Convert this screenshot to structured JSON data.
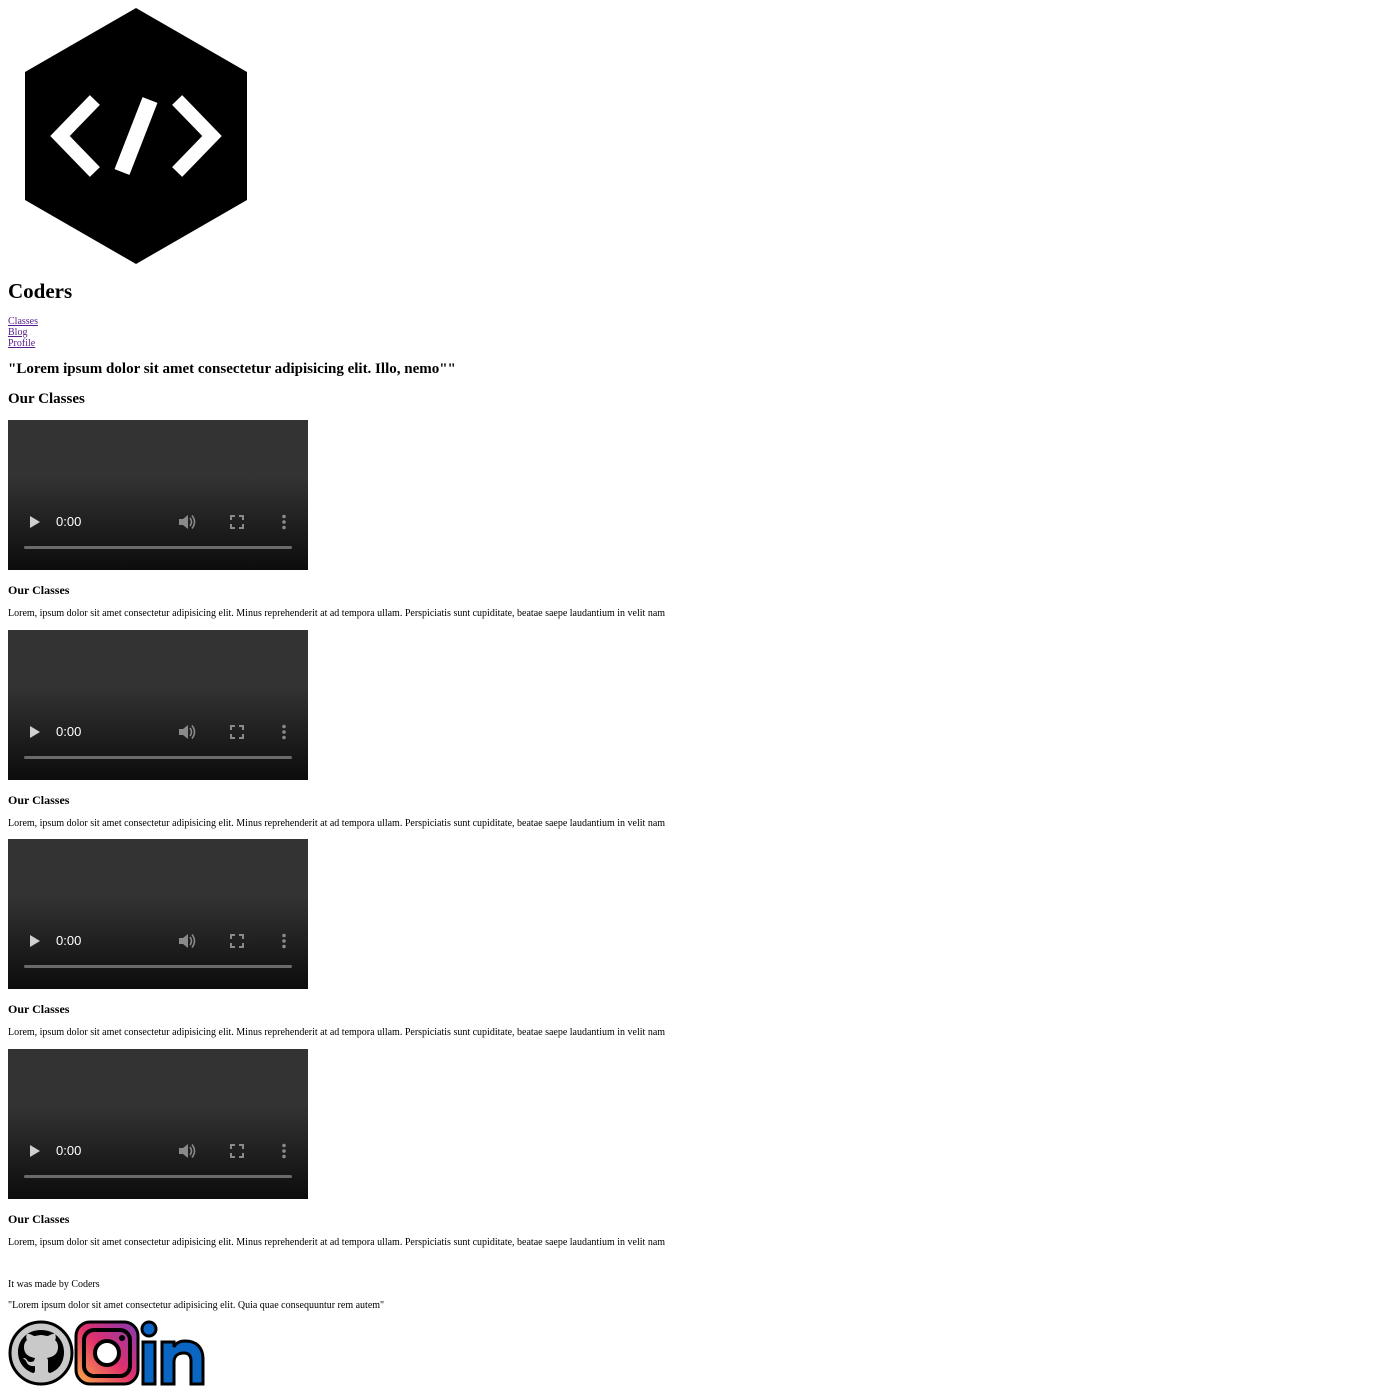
{
  "header": {
    "logo_icon": "code-hexagon-logo",
    "title": "Coders",
    "nav": [
      "Classes",
      "Blog",
      "Profile"
    ]
  },
  "hero": {
    "quote": "\"Lorem ipsum dolor sit amet consectetur adipisicing elit. Illo, nemo\"\""
  },
  "classes": {
    "heading": "Our Classes",
    "items": [
      {
        "video_time": "0:00",
        "title": "Our Classes",
        "text": "Lorem, ipsum dolor sit amet consectetur adipisicing elit. Minus reprehenderit at ad tempora ullam. Perspiciatis sunt cupiditate, beatae saepe laudantium in velit nam"
      },
      {
        "video_time": "0:00",
        "title": "Our Classes",
        "text": "Lorem, ipsum dolor sit amet consectetur adipisicing elit. Minus reprehenderit at ad tempora ullam. Perspiciatis sunt cupiditate, beatae saepe laudantium in velit nam"
      },
      {
        "video_time": "0:00",
        "title": "Our Classes",
        "text": "Lorem, ipsum dolor sit amet consectetur adipisicing elit. Minus reprehenderit at ad tempora ullam. Perspiciatis sunt cupiditate, beatae saepe laudantium in velit nam"
      },
      {
        "video_time": "0:00",
        "title": "Our Classes",
        "text": "Lorem, ipsum dolor sit amet consectetur adipisicing elit. Minus reprehenderit at ad tempora ullam. Perspiciatis sunt cupiditate, beatae saepe laudantium in velit nam"
      }
    ]
  },
  "footer": {
    "made_by": "It was made by Coders",
    "quote": "\"Lorem ipsum dolor sit amet consectetur adipisicing elit. Quia quae consequuntur rem autem\"",
    "social_icons": [
      "github-icon",
      "instagram-icon",
      "linkedin-icon"
    ]
  },
  "colors": {
    "link_visited": "#551a8b",
    "video_bg_top": "#333333",
    "video_bg_bottom": "#0c0c0c",
    "instagram_gradient": [
      "#fcaf45",
      "#e1306c",
      "#833ab4"
    ],
    "linkedin": "#0a66c2",
    "github_gray": "#c9c9c9"
  }
}
